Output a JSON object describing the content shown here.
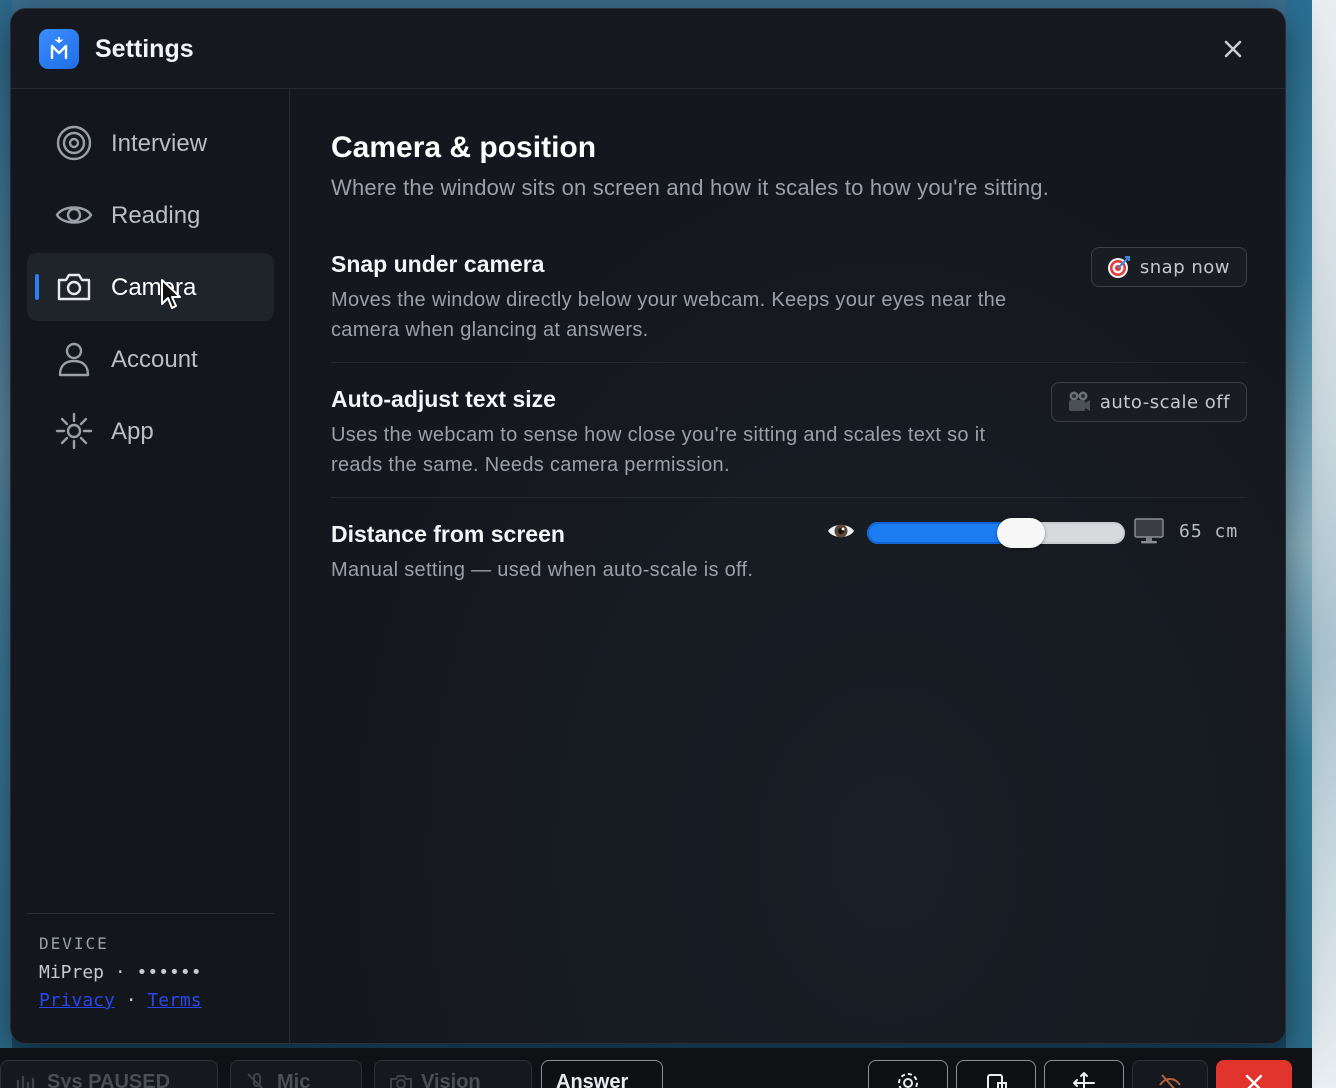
{
  "window": {
    "title": "Settings",
    "logo_icon": "mi-logo-icon",
    "close_icon": "close-icon"
  },
  "sidebar": {
    "items": [
      {
        "label": "Interview",
        "icon": "target-icon",
        "active": false
      },
      {
        "label": "Reading",
        "icon": "eye-icon",
        "active": false
      },
      {
        "label": "Camera",
        "icon": "camera-icon",
        "active": true
      },
      {
        "label": "Account",
        "icon": "person-icon",
        "active": false
      },
      {
        "label": "App",
        "icon": "sun-icon",
        "active": false
      }
    ],
    "footer": {
      "device_label": "DEVICE",
      "device_value": "MiPrep · ••••••",
      "privacy_link": "Privacy",
      "separator": "·",
      "terms_link": "Terms"
    }
  },
  "main": {
    "title": "Camera & position",
    "subtitle": "Where the window sits on screen and how it scales to how you're sitting.",
    "settings": [
      {
        "title": "Snap under camera",
        "description": "Moves the window directly below your webcam. Keeps your eyes near the camera when glancing at answers.",
        "button_label": "snap now",
        "button_icon": "target-dart-icon"
      },
      {
        "title": "Auto-adjust text size",
        "description": "Uses the webcam to sense how close you're sitting and scales text so it reads the same. Needs camera permission.",
        "button_label": "auto-scale off",
        "button_icon": "video-camera-icon"
      },
      {
        "title": "Distance from screen",
        "description": "Manual setting — used when auto-scale is off.",
        "slider_value_fraction": 0.6,
        "slider_value_label": "65 cm",
        "slider_left_icon": "eye-emoji-icon",
        "slider_right_icon": "monitor-icon"
      }
    ]
  },
  "taskbar": {
    "buttons": [
      {
        "label": "Sys PAUSED",
        "icon": "waveform-icon"
      },
      {
        "label": "Mic",
        "icon": "mic-off-icon"
      },
      {
        "label": "Vision",
        "icon": "camera-icon"
      },
      {
        "label": "Answer"
      },
      {
        "icon": "gear-icon"
      },
      {
        "icon": "window-icon"
      },
      {
        "icon": "move-icon"
      },
      {
        "icon": "eye-off-icon"
      },
      {
        "icon": "close-icon"
      }
    ]
  },
  "colors": {
    "accent": "#1d7cf2",
    "window_bg": "#14171d",
    "active_nav_bg": "#1f232a",
    "link": "#2a47ee",
    "danger": "#e1342c"
  }
}
